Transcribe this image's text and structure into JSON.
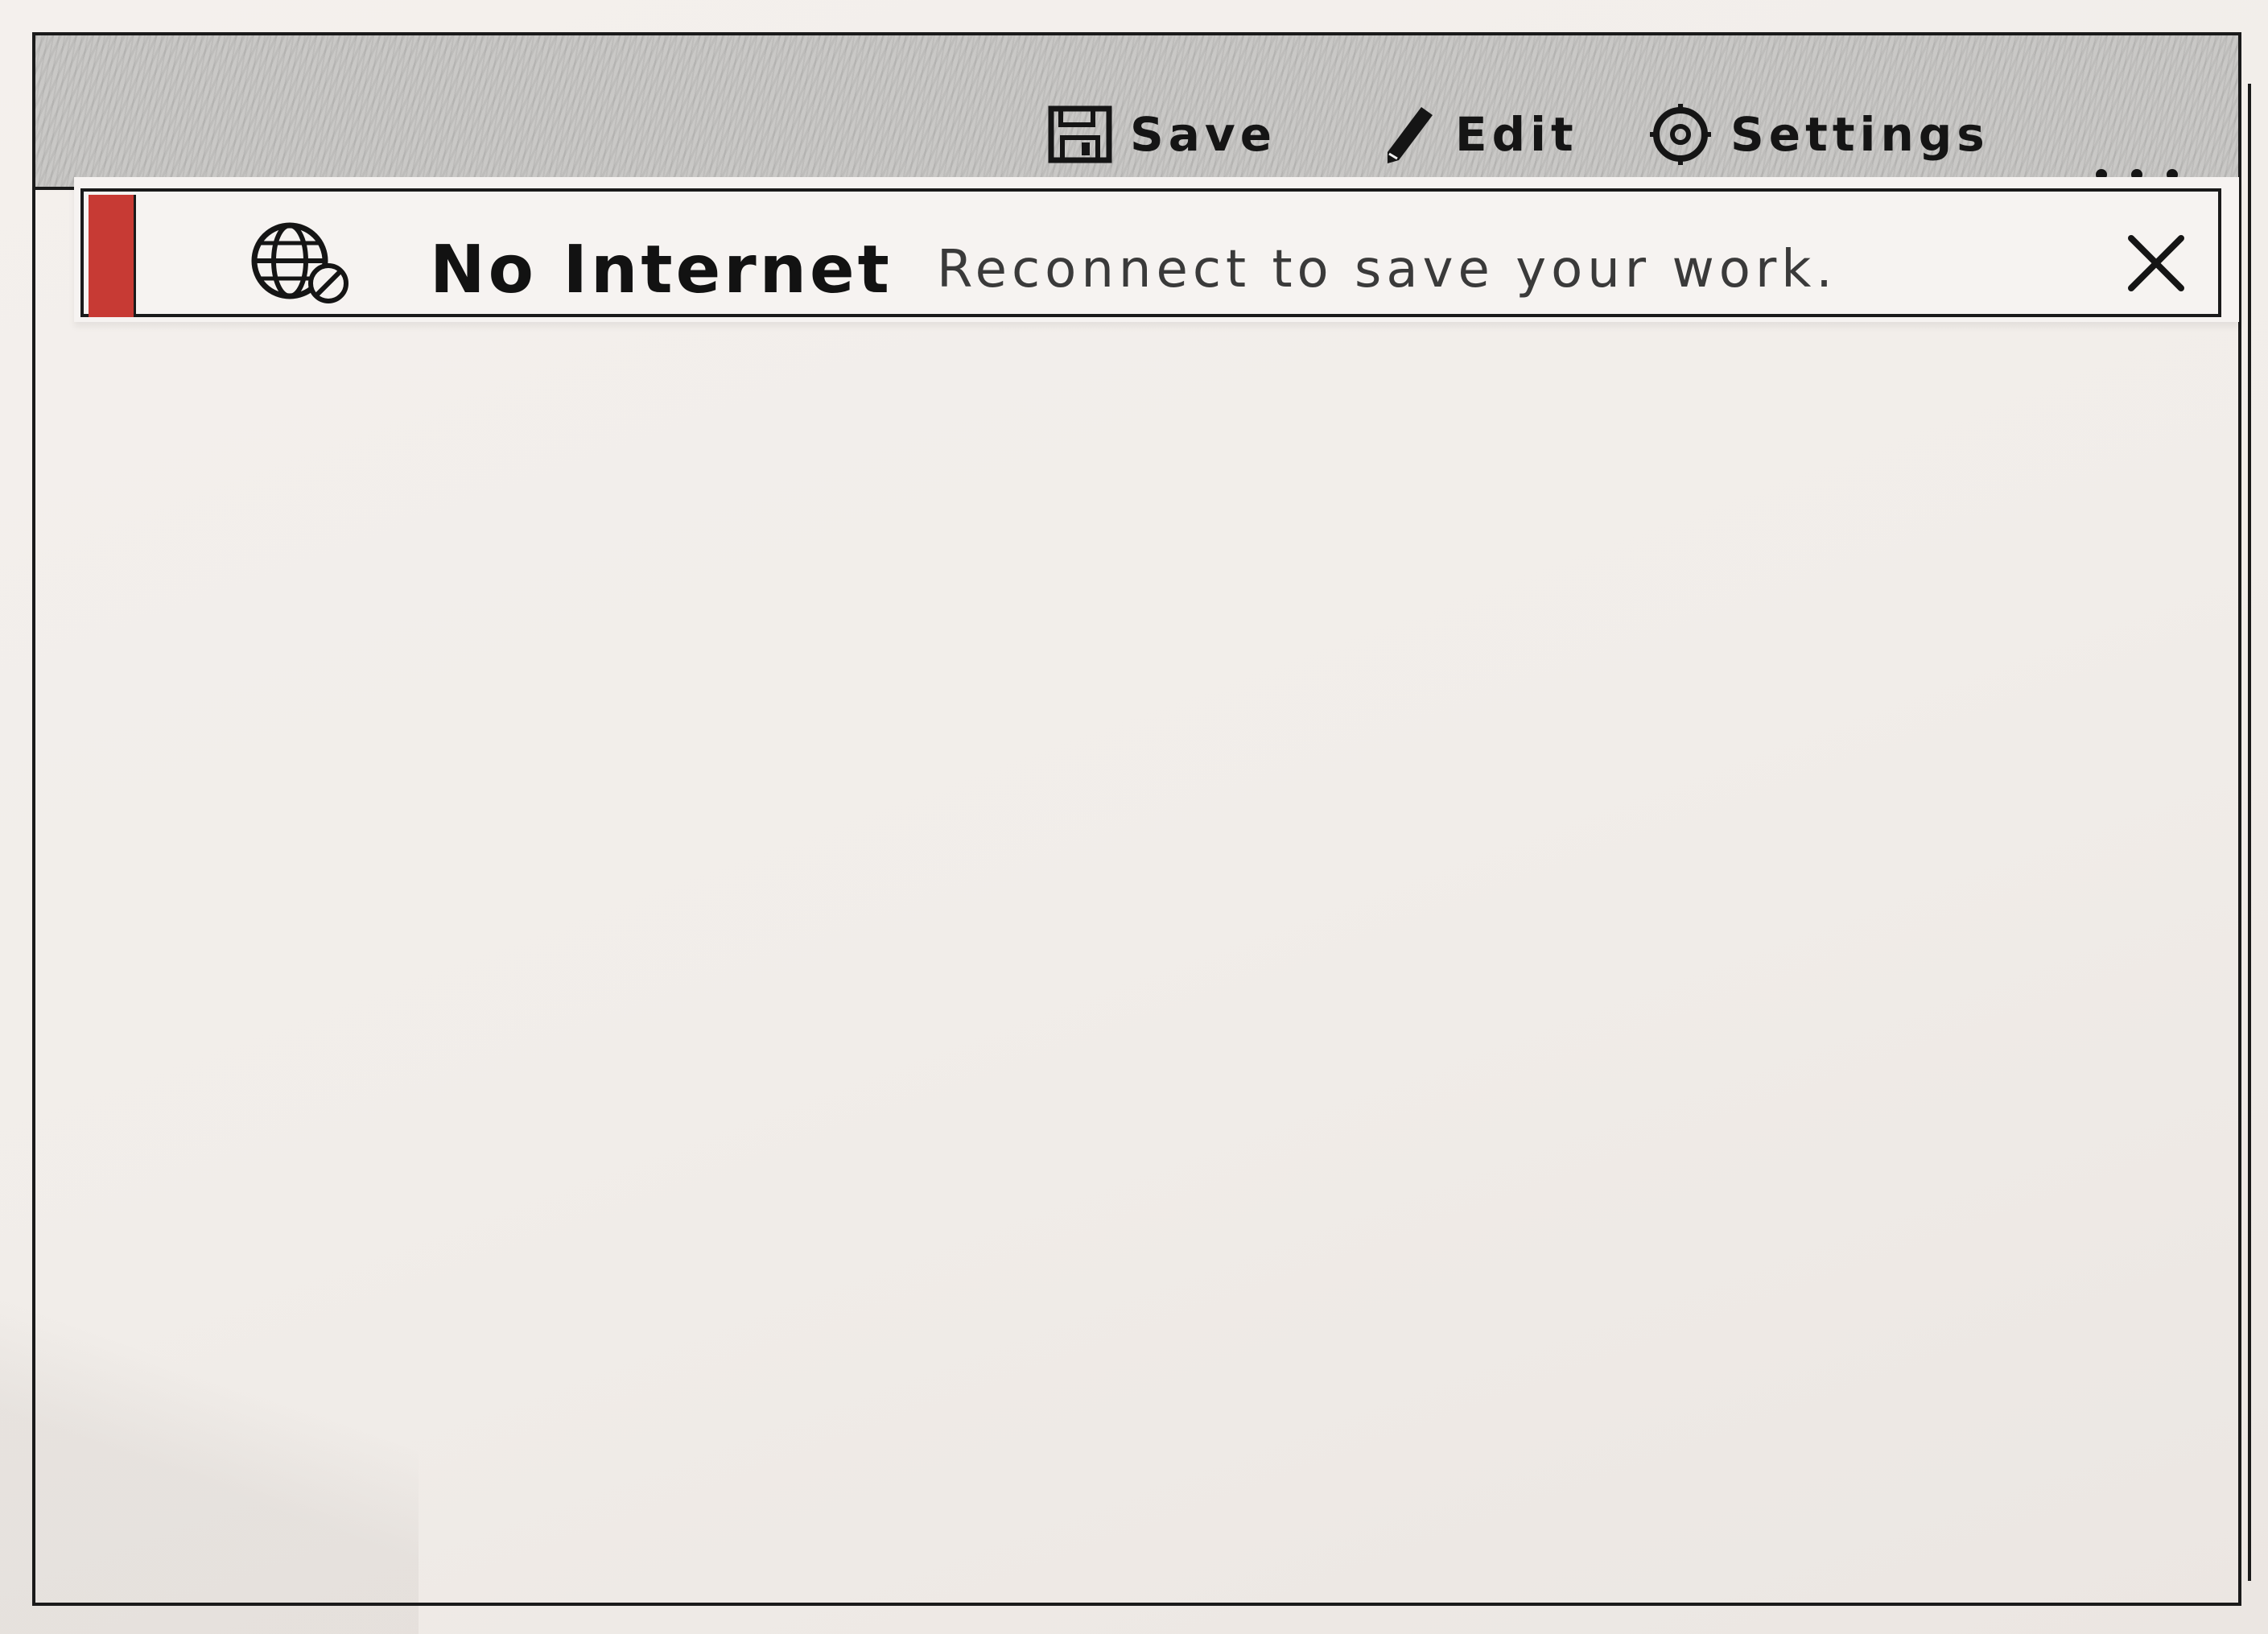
{
  "toolbar": {
    "save_label": "Save",
    "edit_label": "Edit",
    "settings_label": "Settings",
    "more_icon": "more-horizontal-icon"
  },
  "banner": {
    "title": "No Internet",
    "message": "Reconnect to save your work.",
    "icon": "globe-offline-icon",
    "close_icon": "close-icon",
    "accent_color": "#c73a34"
  }
}
